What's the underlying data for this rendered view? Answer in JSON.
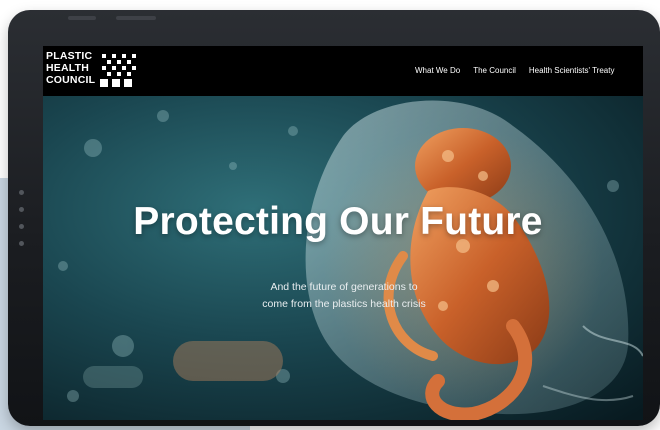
{
  "brand": {
    "name_lines": [
      "PLASTIC",
      "HEALTH",
      "COUNCIL"
    ]
  },
  "nav": {
    "items": [
      {
        "label": "What We Do"
      },
      {
        "label": "The Council"
      },
      {
        "label": "Health Scientists' Treaty"
      }
    ]
  },
  "hero": {
    "title": "Protecting Our Future",
    "subtitle": "And the future of generations to come from the plastics health crisis"
  },
  "colors": {
    "nav_background": "#000000",
    "nav_text": "#ffffff",
    "hero_water": "#0d2a33",
    "figure_orange": "#d9732f",
    "device_frame": "#1b1d21",
    "backdrop_panel": "#c9d6e2"
  }
}
